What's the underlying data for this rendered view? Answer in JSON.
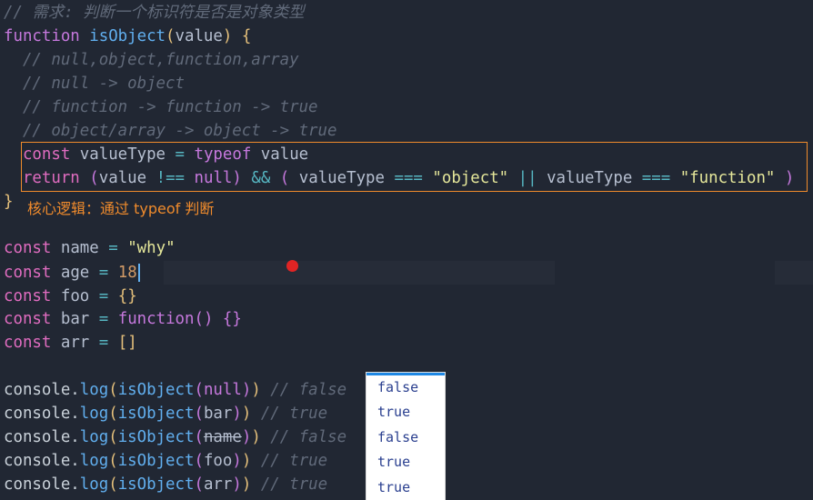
{
  "code": {
    "header_comment": "// 需求: 判断一个标识符是否是对象类型",
    "kw_function": "function",
    "fn_name": "isObject",
    "param": "value",
    "brace_open": " {",
    "comments": [
      "// null,object,function,array",
      "// null -> object",
      "// function -> function -> true",
      "// object/array -> object -> true"
    ],
    "const_kw": "const",
    "value_type_var": "valueType",
    "eq": "=",
    "typeof_kw": "typeof",
    "return_kw": "return",
    "null_kw": "null",
    "not_eq": "!==",
    "and_op": "&&",
    "strict_eq": "===",
    "or_op": "||",
    "str_object": "\"object\"",
    "str_function": "\"function\"",
    "brace_close": "}",
    "decl_name": "name",
    "decl_name_val": "\"why\"",
    "decl_age": "age",
    "decl_age_val": "18",
    "decl_foo": "foo",
    "decl_foo_val": "{}",
    "decl_bar": "bar",
    "decl_bar_val": "function() {}",
    "decl_arr": "arr",
    "decl_arr_val": "[]",
    "console": "console",
    "log": "log",
    "calls": [
      {
        "arg": "null",
        "comment": "// false"
      },
      {
        "arg": "bar",
        "comment": "// true"
      },
      {
        "arg": "name",
        "comment": "// false"
      },
      {
        "arg": "foo",
        "comment": "// true"
      },
      {
        "arg": "arr",
        "comment": "// true"
      }
    ]
  },
  "annotation": "核心逻辑：通过 typeof 判断",
  "results": [
    "false",
    "true",
    "false",
    "true",
    "true"
  ],
  "colors": {
    "highlight_border": "#f08b2c",
    "panel_accent": "#1e88e5"
  }
}
